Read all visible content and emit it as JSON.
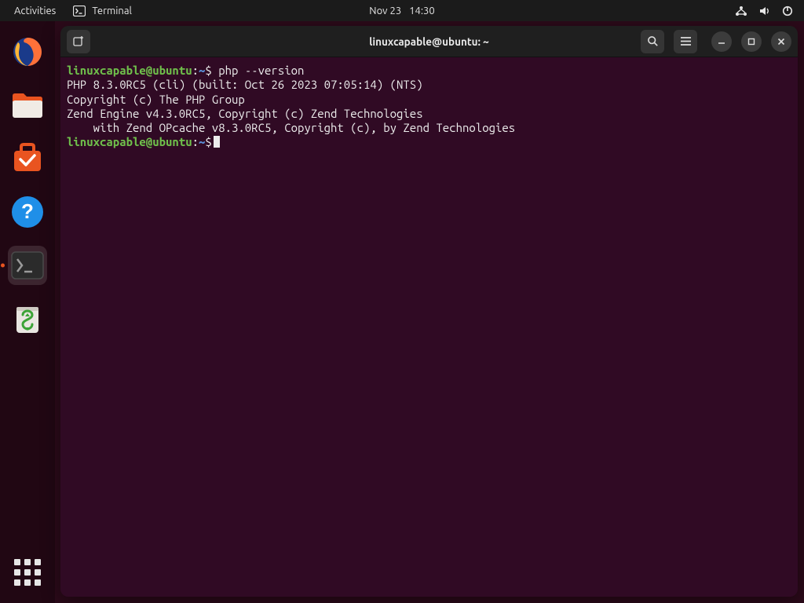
{
  "panel": {
    "activities": "Activities",
    "app_name": "Terminal",
    "date": "Nov 23",
    "time": "14:30"
  },
  "dock": {
    "items": [
      {
        "name": "firefox"
      },
      {
        "name": "files"
      },
      {
        "name": "software"
      },
      {
        "name": "help"
      },
      {
        "name": "terminal",
        "active": true
      },
      {
        "name": "trash"
      }
    ]
  },
  "window": {
    "title": "linuxcapable@ubuntu: ~"
  },
  "terminal": {
    "prompt": {
      "userhost": "linuxcapable@ubuntu",
      "colon": ":",
      "path": "~",
      "dollar": "$"
    },
    "command1": "php --version",
    "output": [
      "PHP 8.3.0RC5 (cli) (built: Oct 26 2023 07:05:14) (NTS)",
      "Copyright (c) The PHP Group",
      "Zend Engine v4.3.0RC5, Copyright (c) Zend Technologies",
      "    with Zend OPcache v8.3.0RC5, Copyright (c), by Zend Technologies"
    ]
  }
}
